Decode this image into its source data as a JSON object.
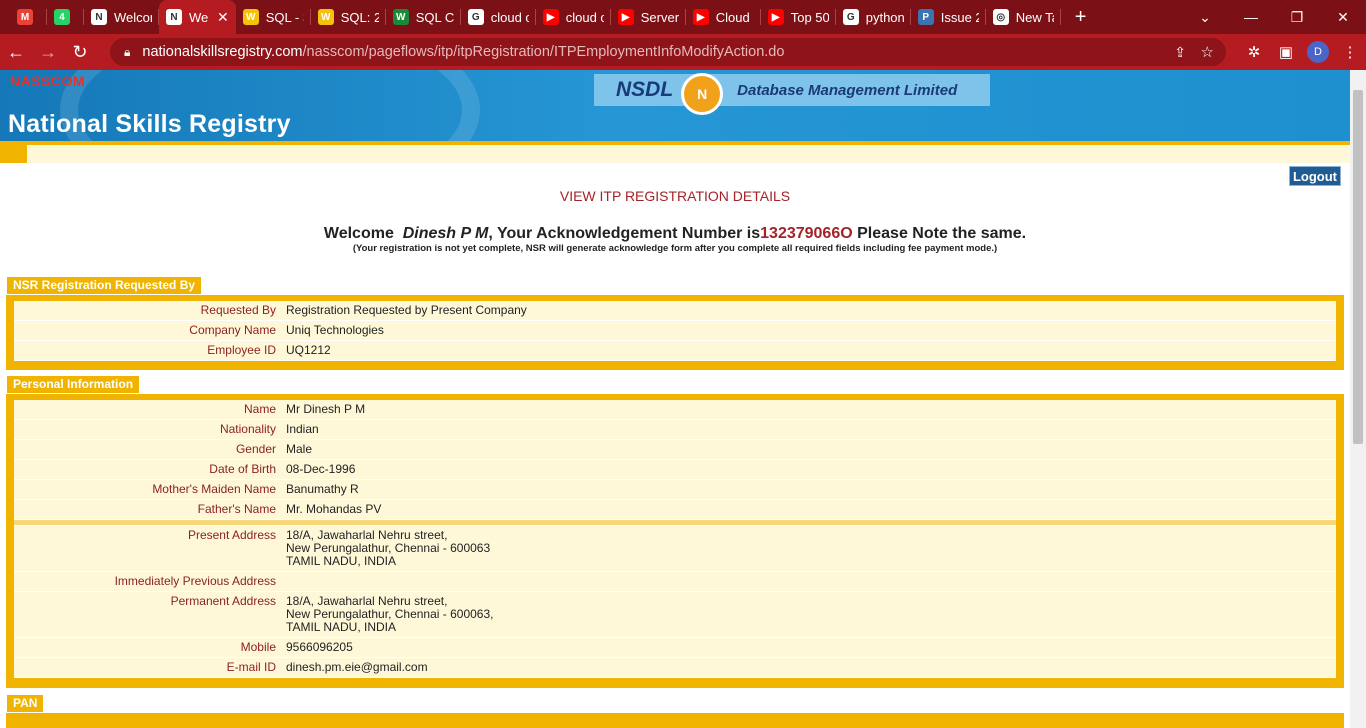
{
  "browser": {
    "tabs": [
      {
        "title": "",
        "icon": "gmail-icon",
        "color": "#ea4335",
        "glyph": "M"
      },
      {
        "title": "",
        "icon": "whatsapp-icon",
        "color": "#25d366",
        "glyph": "4"
      },
      {
        "title": "Welcom",
        "icon": "nsr-icon",
        "color": "#ffffff",
        "glyph": "N"
      },
      {
        "title": "We",
        "icon": "nsr-icon",
        "color": "#ffffff",
        "glyph": "N",
        "active": true
      },
      {
        "title": "SQL - S",
        "icon": "w3-icon",
        "color": "#f4c20d",
        "glyph": "W"
      },
      {
        "title": "SQL: 2",
        "icon": "w3-icon",
        "color": "#f4c20d",
        "glyph": "W"
      },
      {
        "title": "SQL CA",
        "icon": "w-green-icon",
        "color": "#1a8a3a",
        "glyph": "W"
      },
      {
        "title": "cloud c",
        "icon": "google-icon",
        "color": "#ffffff",
        "glyph": "G"
      },
      {
        "title": "cloud c",
        "icon": "youtube-icon",
        "color": "#ff0000",
        "glyph": "▶"
      },
      {
        "title": "Serverle",
        "icon": "youtube-icon",
        "color": "#ff0000",
        "glyph": "▶"
      },
      {
        "title": "Cloud C",
        "icon": "youtube-icon",
        "color": "#ff0000",
        "glyph": "▶"
      },
      {
        "title": "Top 50",
        "icon": "youtube-icon",
        "color": "#ff0000",
        "glyph": "▶"
      },
      {
        "title": "python",
        "icon": "google-icon",
        "color": "#ffffff",
        "glyph": "G"
      },
      {
        "title": "Issue 2",
        "icon": "python-icon",
        "color": "#3b74b0",
        "glyph": "P"
      },
      {
        "title": "New Ta",
        "icon": "chrome-icon",
        "color": "#ffffff",
        "glyph": "◎"
      }
    ],
    "url_host": "nationalskillsregistry.com",
    "url_path": "/nasscom/pageflows/itp/itpRegistration/ITPEmploymentInfoModifyAction.do",
    "profile_initial": "D"
  },
  "header": {
    "nasscom": "NASSCOM",
    "site_title": "National Skills Registry",
    "nsdl_brand": "NSDL",
    "nsdl_desc": "Database Management Limited"
  },
  "logout_label": "Logout",
  "view_title": "VIEW ITP REGISTRATION DETAILS",
  "welcome": {
    "prefix": "Welcome",
    "name": "Dinesh P M",
    "mid": ", Your Acknowledgement Number is",
    "ack_number": "132379066O",
    "suffix": "Please Note the same.",
    "note": "(Your registration is not yet complete, NSR will generate acknowledge form after you complete all required fields including fee payment mode.)"
  },
  "sections": {
    "requested": {
      "title": "NSR Registration Requested By",
      "rows": [
        {
          "label": "Requested By",
          "value": "Registration Requested by Present Company"
        },
        {
          "label": "Company Name",
          "value": "Uniq Technologies"
        },
        {
          "label": "Employee ID",
          "value": "UQ1212"
        }
      ]
    },
    "personal": {
      "title": "Personal Information",
      "rows": [
        {
          "label": "Name",
          "value": "Mr Dinesh P M"
        },
        {
          "label": "Nationality",
          "value": "Indian"
        },
        {
          "label": "Gender",
          "value": "Male"
        },
        {
          "label": "Date of Birth",
          "value": "08-Dec-1996"
        },
        {
          "label": "Mother's Maiden Name",
          "value": "Banumathy R"
        },
        {
          "label": "Father's Name",
          "value": "Mr.  Mohandas PV"
        }
      ],
      "address_rows": [
        {
          "label": "Present Address",
          "lines": [
            "18/A,  Jawaharlal Nehru street,",
            "New Perungalathur, Chennai  -  600063",
            "TAMIL NADU,  INDIA"
          ]
        },
        {
          "label": "Immediately Previous Address",
          "lines": [
            ""
          ]
        },
        {
          "label": "Permanent Address",
          "lines": [
            "18/A,  Jawaharlal Nehru street,",
            "New Perungalathur, Chennai  -  600063,",
            "TAMIL NADU,  INDIA"
          ]
        },
        {
          "label": "Mobile",
          "lines": [
            "9566096205"
          ]
        },
        {
          "label": "E-mail ID",
          "lines": [
            "dinesh.pm.eie@gmail.com"
          ]
        }
      ]
    },
    "pan": {
      "title": "PAN"
    }
  }
}
